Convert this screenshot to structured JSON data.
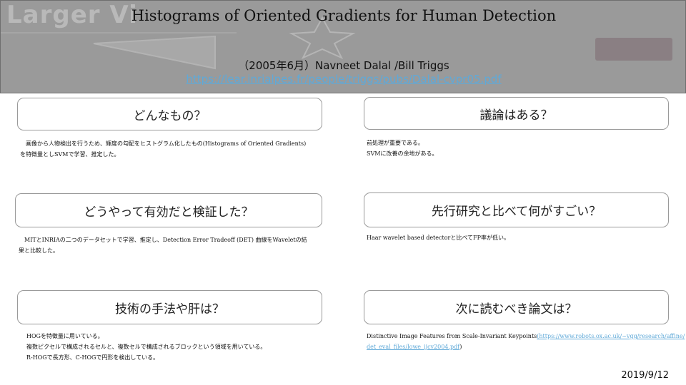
{
  "header": {
    "bg_word": "Larger Vi",
    "title": "Histograms of Oriented Gradients for Human Detection",
    "subtitle": "（2005年6月）Navneet Dalal /Bill Triggs",
    "url": "https://lear.inrialpes.fr/people/triggs/pubs/Dalal-cvpr05.pdf"
  },
  "sections": [
    {
      "question": "どんなもの？",
      "answer_lines": [
        "画像から人物検出を行うため、輝度の勾配をヒストグラム化したもの(Histograms of Oriented Gradients)",
        "を特徴量としSVMで学習、推定した。"
      ]
    },
    {
      "question": "議論はある？",
      "answer_lines": [
        "前処理が重要である。",
        "SVMに改善の余地がある。"
      ]
    },
    {
      "question": "どうやって有効だと検証した？",
      "answer_lines": [
        "MITとINRIAの二つのデータセットで学習、推定し、Detection Error Tradeoff (DET) 曲線をWaveletの結",
        "果と比較した。"
      ]
    },
    {
      "question": "先行研究と比べて何がすごい？",
      "answer_lines": [
        "Haar wavelet based detectorと比べてFP率が低い。"
      ]
    },
    {
      "question": "技術の手法や肝は？",
      "answer_lines": [
        "HOGを特徴量に用いている。",
        "複数ピクセルで構成されるセルと、複数セルで構成されるブロックという領域を用いている。",
        "R-HOGで長方形、C-HOGで円形を検出している。"
      ]
    },
    {
      "question": "次に読むべき論文は？",
      "answer_prefix": "Distinctive Image Features from Scale-Invariant Keypoints",
      "answer_link_1": "(https://www.robots.ox.ac.uk/~vgg/research/affine/",
      "answer_link_2": "det_eval_files/lowe_ijcv2004.pdf",
      "answer_suffix": ")"
    }
  ],
  "footer": {
    "date": "2019/9/12"
  },
  "colors": {
    "banner_bg": "#9a9a9a",
    "link": "#5fa9d8",
    "box_border": "#9a9a9a"
  }
}
